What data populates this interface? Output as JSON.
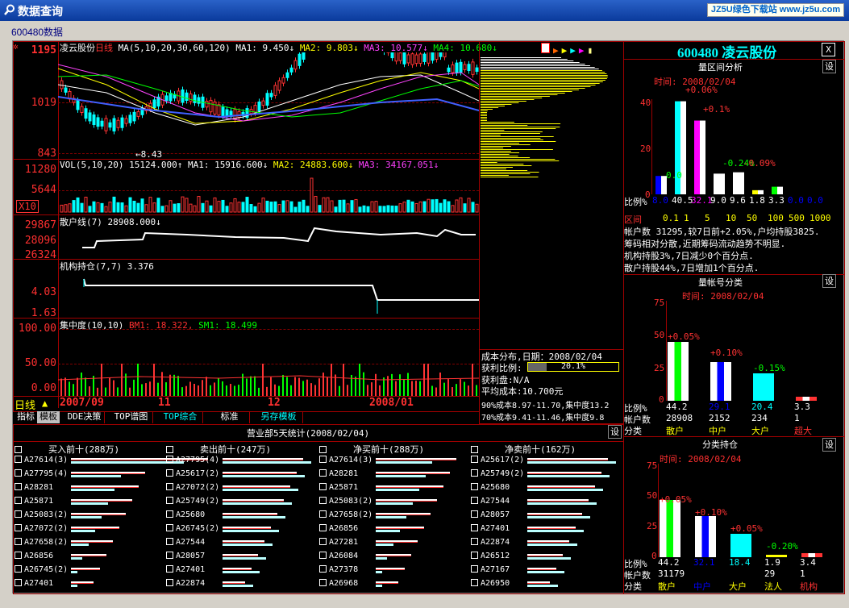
{
  "window": {
    "title": "数据查询",
    "badge": "JZ5U绿色下载站 www.jz5u.com"
  },
  "stock_code_label": "600480数据",
  "chart": {
    "title": "凌云股份",
    "period": "日线",
    "ma_label": "MA(5,10,20,30,60,120)",
    "ma1": "MA1: 9.450↓",
    "ma2": "MA2: 9.803↓",
    "ma3": "MA3: 10.577↓",
    "ma4": "MA4: 10.680↓",
    "price_ticks": [
      "1195",
      "1019",
      "843"
    ],
    "low_mark": "←8.43",
    "vol_title": "VOL(5,10,20) 15124.000↑",
    "vol_ma1": "MA1: 15916.600↓",
    "vol_ma2": "MA2: 24883.600↓",
    "vol_ma3": "MA3: 34167.051↓",
    "vol_ticks": [
      "11280",
      "5644",
      "X10"
    ],
    "retail_title": "散户线(7) 28908.000↓",
    "retail_ticks": [
      "29867",
      "28096",
      "26324"
    ],
    "inst_title": "机构持仓(7,7) 3.376",
    "inst_ticks": [
      "4.03",
      "1.63"
    ],
    "conc_title": "集中度(10,10)",
    "conc_bm1": "BM1: 18.322,",
    "conc_sm1": "SM1: 18.499",
    "conc_ticks": [
      "100.00",
      "50.00",
      "0.00"
    ],
    "axis_period": "日线",
    "dates": [
      "2007/09",
      "11",
      "12",
      "2008/01"
    ],
    "tabs": [
      "指标",
      "模板",
      "DDE决策",
      "TOP谱图",
      "TOP综合",
      "标准",
      "另存模板"
    ]
  },
  "cost": {
    "title": "成本分布,日期：2008/02/04",
    "profit_label": "获利比例:",
    "profit_value": "20.1%",
    "profit_fraction": 0.201,
    "profit_disk": "获利盘:N/A",
    "avg_cost": "平均成本:10.700元",
    "c90": "90%成本8.97-11.70,集中度13.2",
    "c70": "70%成本9.41-11.46,集中度9.8"
  },
  "broker": {
    "title": "营业部5天统计(2008/02/04)",
    "set": "设",
    "cols": [
      {
        "head": "买入前十(288万)",
        "rows": [
          "A27614(3)",
          "A27795(4)",
          "A28281",
          "A25871",
          "A25083(2)",
          "A27072(2)",
          "A27658(2)",
          "A26856",
          "A26745(2)",
          "A27401"
        ]
      },
      {
        "head": "卖出前十(247万)",
        "rows": [
          "A27795(4)",
          "A25617(2)",
          "A27072(2)",
          "A25749(2)",
          "A25680",
          "A26745(2)",
          "A27544",
          "A28057",
          "A27401",
          "A22874"
        ]
      },
      {
        "head": "净买前十(288万)",
        "rows": [
          "A27614(3)",
          "A28281",
          "A25871",
          "A25083(2)",
          "A27658(2)",
          "A26856",
          "A27281",
          "A26084",
          "A27378",
          "A26968"
        ]
      },
      {
        "head": "净卖前十(162万)",
        "rows": [
          "A25617(2)",
          "A25749(2)",
          "A25680",
          "A27544",
          "A28057",
          "A27401",
          "A22874",
          "A26512",
          "A27167",
          "A26950"
        ]
      }
    ]
  },
  "right": {
    "header": "600480 凌云股份",
    "close": "X",
    "set": "设",
    "range": {
      "title": "量区间分析",
      "date": "时间: 2008/02/04",
      "y_ticks": [
        "40",
        "20",
        "0"
      ],
      "pct_labels": [
        "0.0",
        "+0.06%",
        "+0.1%",
        "-0.24%",
        "-0.09%"
      ],
      "ratio_label": "比例%",
      "ratios": [
        "8.0",
        "40.5",
        "32.1",
        "9.0",
        "9.6",
        "1.8",
        "3.3",
        "0.0",
        "0.0"
      ],
      "range_label": "区间",
      "ranges": [
        "0.1",
        "1",
        "5",
        "10",
        "50",
        "100",
        "500",
        "1000"
      ],
      "info": [
        "帐户数 31295,较7日前+2.05%,户均持股3825.",
        "筹码相对分散,近期筹码流动趋势不明显.",
        "机构持股3%,7日减少0个百分点.",
        "散户持股44%,7日增加1个百分点."
      ]
    },
    "acct": {
      "title": "量帐号分类",
      "date": "时间: 2008/02/04",
      "y_ticks": [
        "75",
        "50",
        "25",
        "0"
      ],
      "pct_labels": [
        "+0.05%",
        "+0.10%",
        "-0.15%"
      ],
      "ratio_label": "比例%",
      "ratios": [
        "44.2",
        "29.1",
        "20.4",
        "3.3"
      ],
      "count_label": "帐户数",
      "counts": [
        "28908",
        "2152",
        "234",
        "1"
      ],
      "class_label": "分类",
      "classes": [
        "散户",
        "中户",
        "大户",
        "超大"
      ]
    },
    "hold": {
      "title": "分类持仓",
      "date": "时间: 2008/02/04",
      "y_ticks": [
        "75",
        "50",
        "25",
        "0"
      ],
      "pct_labels": [
        "+0.05%",
        "+0.10%",
        "+0.05%",
        "-0.20%"
      ],
      "ratio_label": "比例%",
      "ratios": [
        "44.2",
        "32.1",
        "18.4",
        "1.9",
        "3.4"
      ],
      "count_label": "帐户数",
      "counts": [
        "31179",
        "",
        "",
        "29",
        "1"
      ],
      "class_label": "分类",
      "classes": [
        "散户",
        "中户",
        "大户",
        "法人",
        "机构"
      ]
    }
  }
}
